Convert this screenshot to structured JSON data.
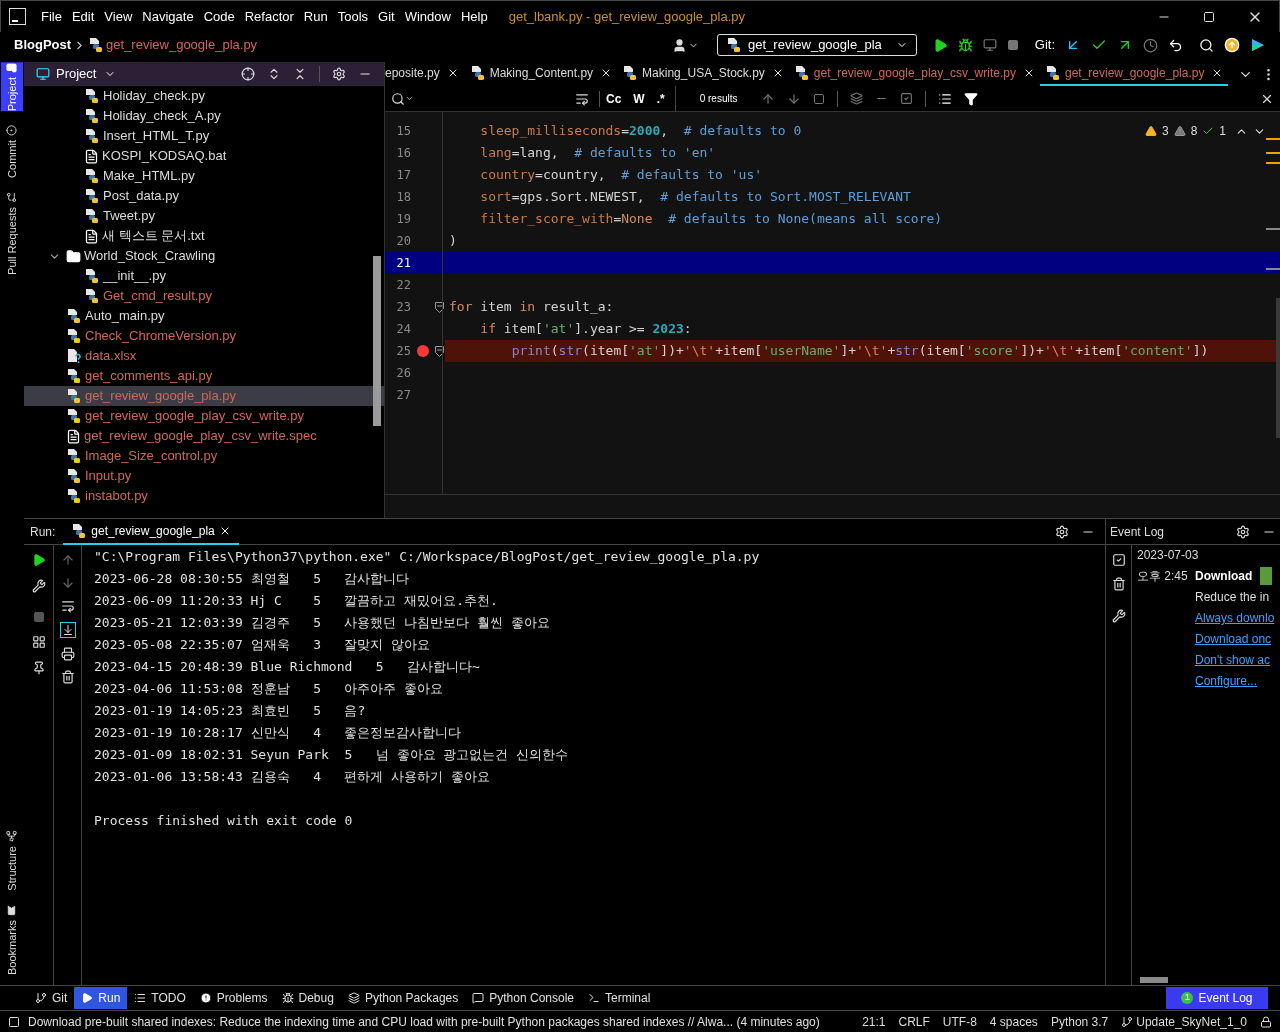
{
  "window": {
    "title": "get_lbank.py - get_review_google_pla.py",
    "menu": [
      "File",
      "Edit",
      "View",
      "Navigate",
      "Code",
      "Refactor",
      "Run",
      "Tools",
      "Git",
      "Window",
      "Help"
    ]
  },
  "navbar": {
    "project": "BlogPost",
    "file": "get_review_google_pla.py",
    "run_config": "get_review_google_pla",
    "git_label": "Git:"
  },
  "side_stripe": {
    "top": [
      {
        "label": "Project",
        "selected": true
      },
      {
        "label": "Commit",
        "selected": false
      },
      {
        "label": "Pull Requests",
        "selected": false
      }
    ],
    "bottom": [
      {
        "label": "Structure",
        "selected": false
      },
      {
        "label": "Bookmarks",
        "selected": false
      }
    ]
  },
  "project_panel": {
    "title": "Project",
    "tree": [
      {
        "kind": "group",
        "children": [
          {
            "kind": "python",
            "label": "Holiday_check.py",
            "unversioned": false,
            "selected": false
          },
          {
            "kind": "python",
            "label": "Holiday_check_A.py",
            "unversioned": false,
            "selected": false
          },
          {
            "kind": "python",
            "label": "Insert_HTML_T.py",
            "unversioned": false,
            "selected": false
          },
          {
            "kind": "text",
            "label": "KOSPI_KODSAQ.bat",
            "unversioned": false,
            "selected": false
          },
          {
            "kind": "python",
            "label": "Make_HTML.py",
            "unversioned": false,
            "selected": false
          },
          {
            "kind": "python",
            "label": "Post_data.py",
            "unversioned": false,
            "selected": false
          },
          {
            "kind": "python",
            "label": "Tweet.py",
            "unversioned": false,
            "selected": false
          },
          {
            "kind": "text",
            "label": "새 텍스트 문서.txt",
            "unversioned": false,
            "selected": false
          }
        ]
      },
      {
        "kind": "folder",
        "label": "World_Stock_Crawling",
        "unversioned": false,
        "selected": false,
        "expanded": true,
        "children": [
          {
            "kind": "python",
            "label": "__init__.py",
            "unversioned": false,
            "selected": false
          },
          {
            "kind": "python",
            "label": "Get_cmd_result.py",
            "unversioned": true,
            "selected": false
          }
        ]
      },
      {
        "kind": "python",
        "label": "Auto_main.py",
        "unversioned": false,
        "selected": false
      },
      {
        "kind": "python",
        "label": "Check_ChromeVersion.py",
        "unversioned": true,
        "selected": false
      },
      {
        "kind": "unknown",
        "label": "data.xlsx",
        "unversioned": true,
        "selected": false
      },
      {
        "kind": "python",
        "label": "get_comments_api.py",
        "unversioned": true,
        "selected": false
      },
      {
        "kind": "python",
        "label": "get_review_google_pla.py",
        "unversioned": true,
        "selected": true
      },
      {
        "kind": "python",
        "label": "get_review_google_play_csv_write.py",
        "unversioned": true,
        "selected": false
      },
      {
        "kind": "text",
        "label": "get_review_google_play_csv_write.spec",
        "unversioned": true,
        "selected": false
      },
      {
        "kind": "python",
        "label": "Image_Size_control.py",
        "unversioned": true,
        "selected": false
      },
      {
        "kind": "python",
        "label": "Input.py",
        "unversioned": true,
        "selected": false
      },
      {
        "kind": "python",
        "label": "instabot.py",
        "unversioned": true,
        "selected": false
      }
    ]
  },
  "editor": {
    "tabs": [
      {
        "label": "eposite.py",
        "icon": false,
        "color": "#dcdcdc",
        "selected": false
      },
      {
        "label": "Making_Content.py",
        "icon": true,
        "color": "#dcdcdc",
        "selected": false
      },
      {
        "label": "Making_USA_Stock.py",
        "icon": true,
        "color": "#dcdcdc",
        "selected": false
      },
      {
        "label": "get_review_google_play_csv_write.py",
        "icon": true,
        "color": "#d1675a",
        "selected": false
      },
      {
        "label": "get_review_google_pla.py",
        "icon": true,
        "color": "#d1675a",
        "selected": true
      }
    ],
    "search": {
      "toggles": [
        "Cc",
        "W",
        ".*"
      ],
      "results": "0 results"
    },
    "inspections": {
      "warnings": "3",
      "weak_warnings": "8",
      "typos": "1"
    },
    "lines": [
      {
        "number": "15",
        "kind": "normal",
        "fold": false,
        "tokens": [
          {
            "kind": "param",
            "text": "    sleep_milliseconds"
          },
          {
            "kind": "plain",
            "text": "="
          },
          {
            "kind": "number",
            "text": "2000"
          },
          {
            "kind": "plain",
            "text": ",  "
          },
          {
            "kind": "comment",
            "text": "# defaults to 0"
          }
        ]
      },
      {
        "number": "16",
        "kind": "normal",
        "fold": false,
        "tokens": [
          {
            "kind": "param",
            "text": "    lang"
          },
          {
            "kind": "plain",
            "text": "=lang,  "
          },
          {
            "kind": "comment",
            "text": "# defaults to 'en'"
          }
        ]
      },
      {
        "number": "17",
        "kind": "normal",
        "fold": false,
        "tokens": [
          {
            "kind": "param",
            "text": "    country"
          },
          {
            "kind": "plain",
            "text": "=country,  "
          },
          {
            "kind": "comment",
            "text": "# defaults to 'us'"
          }
        ]
      },
      {
        "number": "18",
        "kind": "normal",
        "fold": false,
        "tokens": [
          {
            "kind": "param",
            "text": "    sort"
          },
          {
            "kind": "plain",
            "text": "=gps.Sort.NEWEST,  "
          },
          {
            "kind": "comment",
            "text": "# defaults to Sort.MOST_RELEVANT"
          }
        ]
      },
      {
        "number": "19",
        "kind": "normal",
        "fold": false,
        "tokens": [
          {
            "kind": "param",
            "text": "    filter_score_with"
          },
          {
            "kind": "plain",
            "text": "="
          },
          {
            "kind": "keyword",
            "text": "None"
          },
          {
            "kind": "comment",
            "text": "  # defaults to None(means all score)"
          }
        ]
      },
      {
        "number": "20",
        "kind": "normal",
        "fold": false,
        "tokens": [
          {
            "kind": "plain",
            "text": ")"
          }
        ]
      },
      {
        "number": "21",
        "kind": "current",
        "fold": false
      },
      {
        "number": "22",
        "kind": "normal",
        "fold": false
      },
      {
        "number": "23",
        "kind": "normal",
        "fold": true,
        "tokens": [
          {
            "kind": "keyword",
            "text": "for"
          },
          {
            "kind": "plain",
            "text": " item "
          },
          {
            "kind": "keyword",
            "text": "in"
          },
          {
            "kind": "plain",
            "text": " result_a:"
          }
        ]
      },
      {
        "number": "24",
        "kind": "normal",
        "fold": false,
        "tokens": [
          {
            "kind": "keyword",
            "text": "    if"
          },
          {
            "kind": "plain",
            "text": " item["
          },
          {
            "kind": "string",
            "text": "'at'"
          },
          {
            "kind": "plain",
            "text": "].year >= "
          },
          {
            "kind": "number",
            "text": "2023"
          },
          {
            "kind": "plain",
            "text": ":"
          }
        ]
      },
      {
        "number": "25",
        "kind": "breakpoint",
        "fold": true,
        "tokens": [
          {
            "kind": "builtin",
            "text": "        print"
          },
          {
            "kind": "plain",
            "text": "("
          },
          {
            "kind": "builtin",
            "text": "str"
          },
          {
            "kind": "plain",
            "text": "(item["
          },
          {
            "kind": "string",
            "text": "'at'"
          },
          {
            "kind": "plain",
            "text": "])+"
          },
          {
            "kind": "escape",
            "text": "'\\t'"
          },
          {
            "kind": "plain",
            "text": "+item["
          },
          {
            "kind": "string",
            "text": "'userName'"
          },
          {
            "kind": "plain",
            "text": "]+"
          },
          {
            "kind": "escape",
            "text": "'\\t'"
          },
          {
            "kind": "plain",
            "text": "+"
          },
          {
            "kind": "builtin",
            "text": "str"
          },
          {
            "kind": "plain",
            "text": "(item["
          },
          {
            "kind": "string",
            "text": "'score'"
          },
          {
            "kind": "plain",
            "text": "])+"
          },
          {
            "kind": "escape",
            "text": "'\\t'"
          },
          {
            "kind": "plain",
            "text": "+item["
          },
          {
            "kind": "string",
            "text": "'content'"
          },
          {
            "kind": "plain",
            "text": "])"
          }
        ]
      },
      {
        "number": "26",
        "kind": "normal",
        "fold": false
      },
      {
        "number": "27",
        "kind": "normal",
        "fold": false
      }
    ]
  },
  "run_panel": {
    "label": "Run:",
    "tab": "get_review_google_pla",
    "output": [
      "\"C:\\Program Files\\Python37\\python.exe\" C:/Workspace/BlogPost/get_review_google_pla.py",
      "2023-06-28 08:30:55 최영철\t5\t감사합니다",
      "2023-06-09 11:20:33 Hj C\t5\t깔끔하고 재밌어요.추천.",
      "2023-05-21 12:03:39 김경주\t5\t사용했던 나침반보다 훨씬 좋아요",
      "2023-05-08 22:35:07 엄재욱\t3\t잘맞지 않아요",
      "2023-04-15 20:48:39 Blue Richmond\t5\t감사합니다~",
      "2023-04-06 11:53:08 정훈남\t5\t아주아주 좋아요",
      "2023-01-19 14:05:23 최효빈\t5\t음?",
      "2023-01-19 10:28:17 신만식\t4\t좋은정보감사합니다",
      "2023-01-09 18:02:31 Seyun Park\t5\t넘 좋아요 광고없는건 신의한수",
      "2023-01-06 13:58:43 김용숙\t4\t편하게 사용하기 좋아요"
    ],
    "exit_message": "Process finished with exit code 0"
  },
  "event_log": {
    "title": "Event Log",
    "date": "2023-07-03",
    "time": "오후 2:45",
    "heading": "Download",
    "text": "Reduce the in",
    "links": [
      "Always downlo",
      "Download onc",
      "Don't show ac",
      "Configure..."
    ]
  },
  "tool_bar": {
    "items": [
      {
        "kind": "git",
        "label": "Git",
        "selected": false
      },
      {
        "kind": "run",
        "label": "Run",
        "selected": true
      },
      {
        "kind": "todo",
        "label": "TODO",
        "selected": false
      },
      {
        "kind": "problems",
        "label": "Problems",
        "selected": false
      },
      {
        "kind": "debug",
        "label": "Debug",
        "selected": false
      },
      {
        "kind": "packages",
        "label": "Python Packages",
        "selected": false
      },
      {
        "kind": "console",
        "label": "Python Console",
        "selected": false
      },
      {
        "kind": "terminal",
        "label": "Terminal",
        "selected": false
      }
    ],
    "event_log": {
      "label": "Event Log",
      "badge": "1"
    }
  },
  "status_bar": {
    "message": "Download pre-built shared indexes: Reduce the indexing time and CPU load with pre-built Python packages shared indexes // Alwa... (4 minutes ago)",
    "position": "21:1",
    "line_sep": "CRLF",
    "encoding": "UTF-8",
    "indent": "4 spaces",
    "interpreter": "Python 3.7",
    "branch": "Update_SkyNet_1_0"
  }
}
